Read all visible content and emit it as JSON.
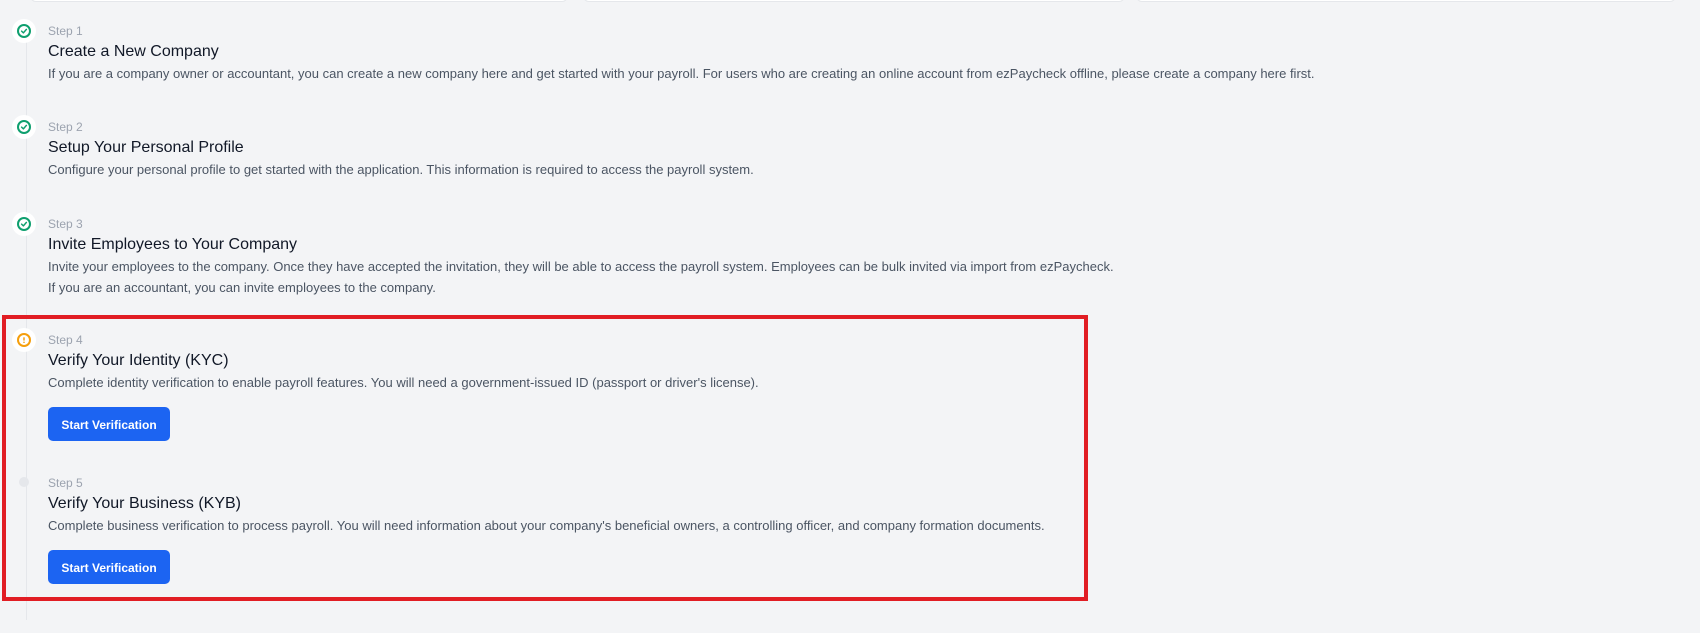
{
  "steps": [
    {
      "label": "Step 1",
      "title": "Create a New Company",
      "description": "If you are a company owner or accountant, you can create a new company here and get started with your payroll. For users who are creating an online account from ezPaycheck offline, please create a company here first.",
      "status": "complete"
    },
    {
      "label": "Step 2",
      "title": "Setup Your Personal Profile",
      "description": "Configure your personal profile to get started with the application. This information is required to access the payroll system.",
      "status": "complete"
    },
    {
      "label": "Step 3",
      "title": "Invite Employees to Your Company",
      "description": "Invite your employees to the company. Once they have accepted the invitation, they will be able to access the payroll system. Employees can be bulk invited via import from ezPaycheck.",
      "description2": "If you are an accountant, you can invite employees to the company.",
      "status": "complete"
    },
    {
      "label": "Step 4",
      "title": "Verify Your Identity (KYC)",
      "description": "Complete identity verification to enable payroll features. You will need a government-issued ID (passport or driver's license).",
      "button_label": "Start Verification",
      "status": "warning"
    },
    {
      "label": "Step 5",
      "title": "Verify Your Business (KYB)",
      "description": "Complete business verification to process payroll. You will need information about your company's beneficial owners, a controlling officer, and company formation documents.",
      "button_label": "Start Verification",
      "status": "pending"
    }
  ],
  "icons": {
    "complete": "check-circle-icon",
    "warning": "exclamation-circle-icon",
    "pending": "dot-icon"
  },
  "colors": {
    "complete": "#0e9f6e",
    "warning": "#f59e0b",
    "button": "#1c64f2",
    "highlight": "#e11d24"
  }
}
